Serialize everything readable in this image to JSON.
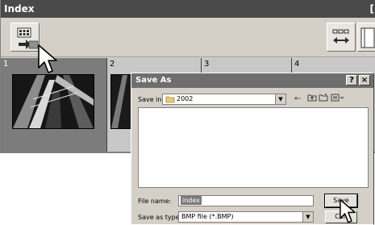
{
  "index_window": {
    "title": "Index",
    "title_trailing": "["
  },
  "thumbnails": [
    {
      "number": "1",
      "selected": true
    },
    {
      "number": "2",
      "selected": false
    },
    {
      "number": "3",
      "selected": false
    },
    {
      "number": "4",
      "selected": false
    }
  ],
  "save_dialog": {
    "title": "Save As",
    "help_button": "?",
    "close_button": "×",
    "save_in_label": "Save in:",
    "save_in_value": "2002",
    "file_name_label": "File name:",
    "file_name_value": "index",
    "save_as_type_label": "Save as type:",
    "save_as_type_value": "BMP file (*.BMP)",
    "save_button": "Save",
    "cancel_button": "Can"
  },
  "colors": {
    "title_bar": "#4a4a4a",
    "selection": "#7c7c7c",
    "face": "#d4d0c8"
  },
  "icons": [
    "index-export-icon",
    "cursor-arrow-icon",
    "view-toggle-icon",
    "folder-icon",
    "back-icon",
    "up-folder-icon",
    "new-folder-icon",
    "view-menu-icon"
  ]
}
